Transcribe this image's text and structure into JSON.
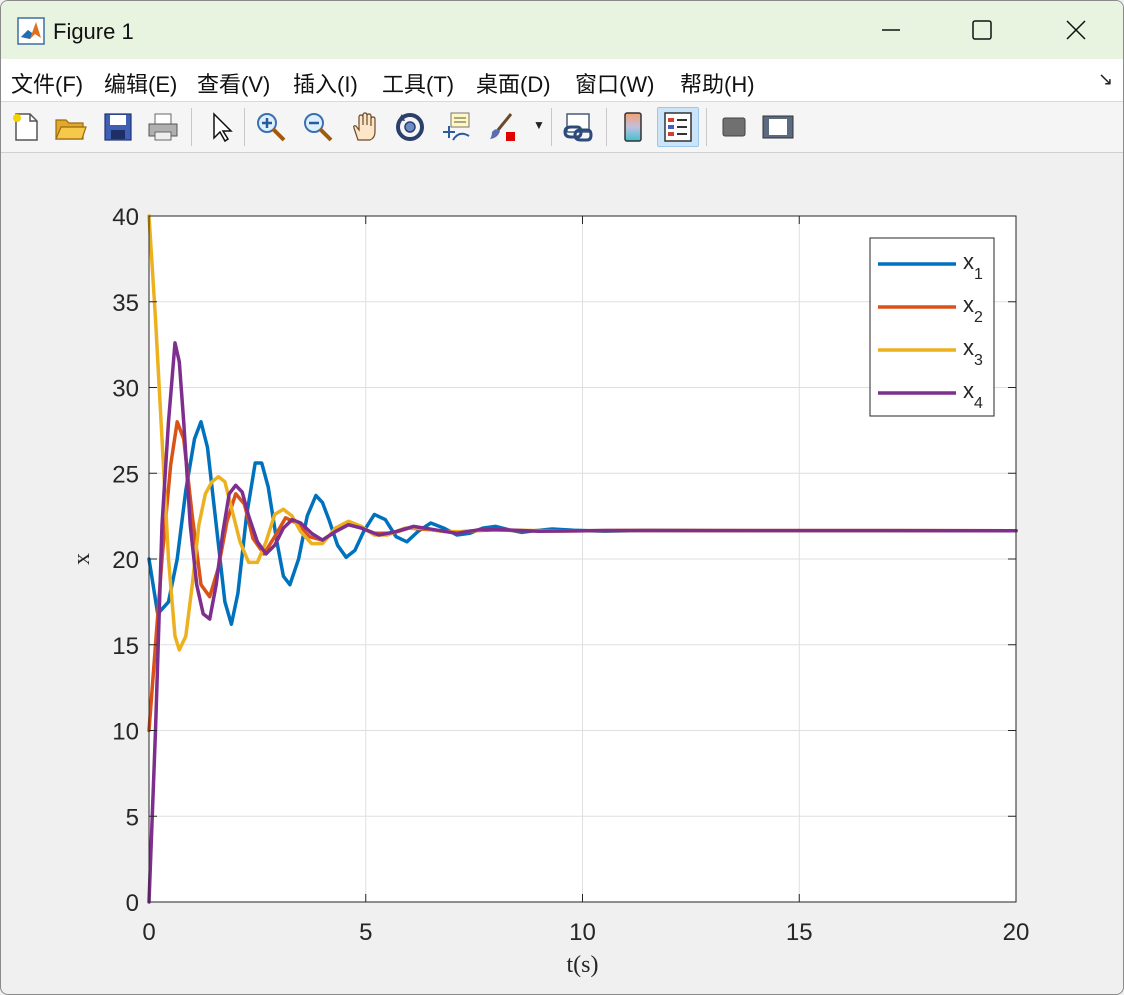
{
  "window": {
    "title": "Figure 1",
    "controls": [
      "minimize",
      "maximize",
      "close"
    ]
  },
  "menu": {
    "items": [
      "文件(F)",
      "编辑(E)",
      "查看(V)",
      "插入(I)",
      "工具(T)",
      "桌面(D)",
      "窗口(W)",
      "帮助(H)"
    ]
  },
  "toolbar": {
    "icons": [
      "new-figure-icon",
      "open-file-icon",
      "save-icon",
      "print-icon",
      "edit-plot-arrow-icon",
      "zoom-in-icon",
      "zoom-out-icon",
      "pan-hand-icon",
      "rotate-3d-icon",
      "data-cursor-icon",
      "brush-icon",
      "link-plot-icon",
      "colorbar-icon",
      "legend-icon",
      "hide-plot-tools-icon",
      "show-plot-tools-icon"
    ],
    "active": "legend-icon"
  },
  "chart_data": {
    "type": "line",
    "xlabel": "t(s)",
    "ylabel": "x",
    "xlim": [
      0,
      20
    ],
    "ylim": [
      0,
      40
    ],
    "xticks": [
      0,
      5,
      10,
      15,
      20
    ],
    "yticks": [
      0,
      5,
      10,
      15,
      20,
      25,
      30,
      35,
      40
    ],
    "grid": true,
    "legend_position": "top-right",
    "series": [
      {
        "name": "x_1",
        "color": "#0072BD",
        "x": [
          0,
          0.2,
          0.45,
          0.65,
          0.85,
          1.05,
          1.2,
          1.35,
          1.55,
          1.75,
          1.9,
          2.05,
          2.25,
          2.45,
          2.6,
          2.75,
          2.95,
          3.1,
          3.25,
          3.45,
          3.65,
          3.85,
          4.0,
          4.15,
          4.35,
          4.55,
          4.75,
          4.95,
          5.2,
          5.45,
          5.7,
          5.95,
          6.2,
          6.5,
          6.8,
          7.1,
          7.4,
          7.7,
          8.0,
          8.3,
          8.6,
          8.9,
          9.3,
          9.8,
          10.5,
          11.5,
          13,
          20
        ],
        "y": [
          20,
          16.8,
          17.5,
          20,
          24,
          27,
          28,
          26.5,
          22,
          17.5,
          16.2,
          18,
          22.5,
          25.6,
          25.6,
          24.2,
          21,
          19,
          18.5,
          20,
          22.5,
          23.7,
          23.3,
          22.3,
          20.8,
          20.1,
          20.5,
          21.6,
          22.6,
          22.3,
          21.3,
          21,
          21.6,
          22.1,
          21.8,
          21.4,
          21.5,
          21.8,
          21.9,
          21.7,
          21.55,
          21.65,
          21.75,
          21.68,
          21.62,
          21.67,
          21.65,
          21.65
        ]
      },
      {
        "name": "x_2",
        "color": "#D95319",
        "x": [
          0,
          0.3,
          0.5,
          0.65,
          0.8,
          1.0,
          1.2,
          1.4,
          1.6,
          1.8,
          2.0,
          2.2,
          2.4,
          2.65,
          2.9,
          3.15,
          3.4,
          3.7,
          4.0,
          4.3,
          4.6,
          4.9,
          5.2,
          5.6,
          6.0,
          6.5,
          7.0,
          7.5,
          8.0,
          8.5,
          9.5,
          11,
          20
        ],
        "y": [
          10,
          20,
          25.5,
          28,
          27,
          22.5,
          18.5,
          17.8,
          19.5,
          22.2,
          23.8,
          23.2,
          21.2,
          20.3,
          21.3,
          22.4,
          22.1,
          21.3,
          21.1,
          21.6,
          22,
          21.8,
          21.5,
          21.5,
          21.8,
          21.7,
          21.55,
          21.65,
          21.7,
          21.65,
          21.63,
          21.66,
          21.65
        ]
      },
      {
        "name": "x_3",
        "color": "#EDB120",
        "x": [
          0,
          0.15,
          0.3,
          0.45,
          0.6,
          0.7,
          0.85,
          1.0,
          1.15,
          1.3,
          1.45,
          1.6,
          1.75,
          1.9,
          2.1,
          2.3,
          2.5,
          2.7,
          2.9,
          3.1,
          3.3,
          3.5,
          3.75,
          4.0,
          4.3,
          4.6,
          4.9,
          5.2,
          5.5,
          5.9,
          6.3,
          6.8,
          7.3,
          7.8,
          8.5,
          9.5,
          11,
          20
        ],
        "y": [
          40,
          34,
          27,
          20,
          15.5,
          14.7,
          15.5,
          18.5,
          22,
          23.8,
          24.5,
          24.8,
          24.5,
          23,
          21,
          19.8,
          19.8,
          21,
          22.6,
          22.9,
          22.5,
          21.6,
          20.9,
          20.9,
          21.8,
          22.2,
          21.9,
          21.4,
          21.4,
          21.8,
          21.8,
          21.6,
          21.6,
          21.7,
          21.68,
          21.64,
          21.66,
          21.65
        ]
      },
      {
        "name": "x_4",
        "color": "#7E2F8E",
        "x": [
          0,
          0.15,
          0.3,
          0.45,
          0.6,
          0.7,
          0.8,
          0.95,
          1.1,
          1.25,
          1.4,
          1.55,
          1.7,
          1.85,
          2.0,
          2.15,
          2.3,
          2.5,
          2.7,
          2.9,
          3.1,
          3.3,
          3.5,
          3.75,
          4.0,
          4.3,
          4.6,
          4.9,
          5.3,
          5.7,
          6.1,
          6.6,
          7.1,
          7.6,
          8.2,
          9.0,
          10.5,
          20
        ],
        "y": [
          0,
          10,
          22,
          28,
          32.6,
          31.5,
          28,
          22,
          18.5,
          16.8,
          16.5,
          18.5,
          21.5,
          23.8,
          24.3,
          23.9,
          22.5,
          21,
          20.3,
          20.8,
          21.8,
          22.3,
          22.1,
          21.5,
          21.1,
          21.6,
          22,
          21.8,
          21.4,
          21.6,
          21.9,
          21.7,
          21.5,
          21.7,
          21.7,
          21.62,
          21.66,
          21.65
        ]
      }
    ]
  }
}
